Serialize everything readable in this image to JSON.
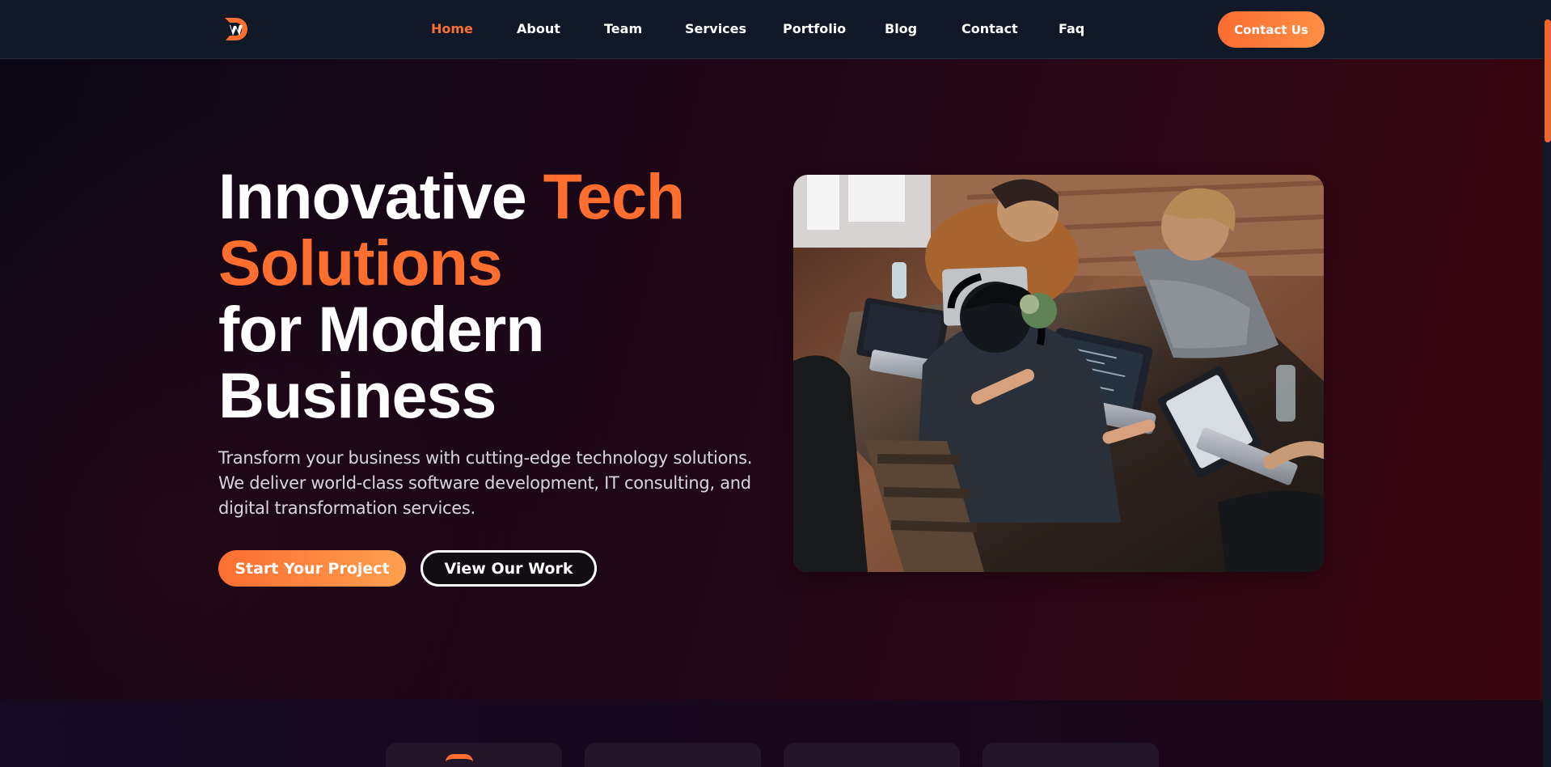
{
  "header": {
    "logo": {
      "icon": "dw-logo-icon",
      "letters": "DW"
    },
    "nav": [
      {
        "label": "Home",
        "active": true
      },
      {
        "label": "About",
        "active": false
      },
      {
        "label": "Team",
        "active": false
      },
      {
        "label": "Services",
        "active": false
      },
      {
        "label": "Portfolio",
        "active": false
      },
      {
        "label": "Blog",
        "active": false
      },
      {
        "label": "Contact",
        "active": false
      },
      {
        "label": "Faq",
        "active": false
      }
    ],
    "cta_label": "Contact Us"
  },
  "hero": {
    "title_line1_white": "Innovative ",
    "title_line1_accent": "Tech",
    "title_line2_accent": "Solutions",
    "title_line3": "for Modern",
    "title_line4": "Business",
    "description_lines": [
      "Transform your business with cutting-edge technology solutions.",
      "We deliver world-class software development, IT consulting, and",
      "digital transformation services."
    ],
    "primary_button": "Start Your Project",
    "secondary_button": "View Our Work",
    "image_subject": "team-working-on-laptops-photo"
  },
  "stats": {
    "card_count_visible": 4
  },
  "colors": {
    "accent": "#ff6d2f",
    "header_bg": "#111827",
    "hero_dark": "#0b0714",
    "hero_red": "#39070f",
    "text_white": "#ffffff",
    "text_muted": "#d8d6dd"
  }
}
